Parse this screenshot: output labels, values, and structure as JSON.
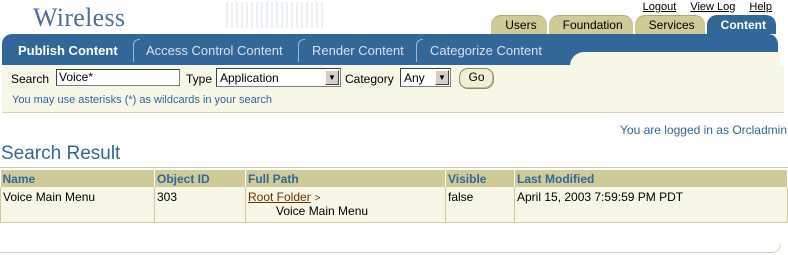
{
  "app": {
    "brand": "Wireless"
  },
  "global_links": [
    "Logout",
    "View Log",
    "Help"
  ],
  "tabs": [
    {
      "label": "Users",
      "active": false
    },
    {
      "label": "Foundation",
      "active": false
    },
    {
      "label": "Services",
      "active": false
    },
    {
      "label": "Content",
      "active": true
    }
  ],
  "subtabs": [
    {
      "label": "Publish Content",
      "active": true
    },
    {
      "label": "Access Control Content",
      "active": false
    },
    {
      "label": "Render Content",
      "active": false
    },
    {
      "label": "Categorize Content",
      "active": false
    }
  ],
  "search": {
    "search_label": "Search",
    "search_value": "Voice*",
    "type_label": "Type",
    "type_value": "Application",
    "category_label": "Category",
    "category_value": "Any",
    "go_label": "Go",
    "hint": "You may use asterisks (*) as wildcards in your search"
  },
  "login_text": "You are logged in as Orcladmin",
  "results": {
    "title": "Search Result",
    "columns": [
      "Name",
      "Object ID",
      "Full Path",
      "Visible",
      "Last Modified"
    ],
    "rows": [
      {
        "name": "Voice Main Menu",
        "object_id": "303",
        "path_root": "Root Folder",
        "path_sep": ">",
        "path_leaf": "Voice Main Menu",
        "visible": "false",
        "last_modified": "April 15, 2003 7:59:59 PM PDT"
      }
    ]
  },
  "colors": {
    "brand_blue": "#336699",
    "tab_tan": "#cfcb98",
    "panel_bg": "#f7f7e7",
    "link_brown": "#663300"
  }
}
